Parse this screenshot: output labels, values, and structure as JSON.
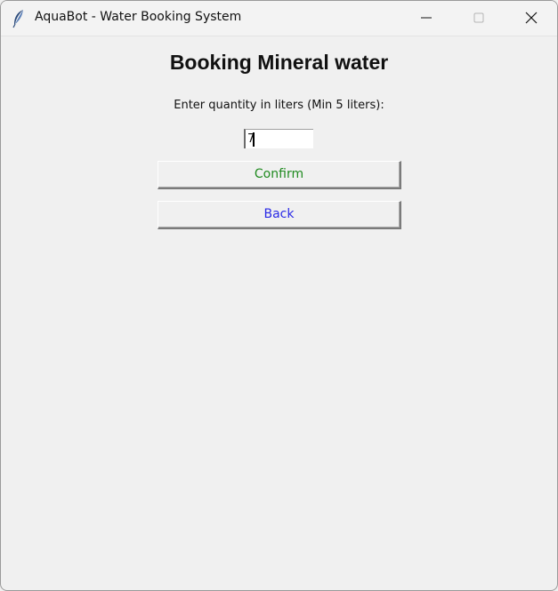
{
  "window": {
    "title": "AquaBot - Water Booking System",
    "app_icon": "feather-icon",
    "controls": {
      "minimize_icon": "minimize-icon",
      "maximize_icon": "maximize-icon",
      "close_icon": "close-icon"
    }
  },
  "main": {
    "heading": "Booking Mineral water",
    "prompt": "Enter quantity in liters (Min 5 liters):",
    "quantity_value": "7",
    "confirm_label": "Confirm",
    "back_label": "Back"
  },
  "colors": {
    "confirm_text": "#1f8a1f",
    "back_text": "#2a2ae6",
    "background": "#f0f0f0"
  }
}
